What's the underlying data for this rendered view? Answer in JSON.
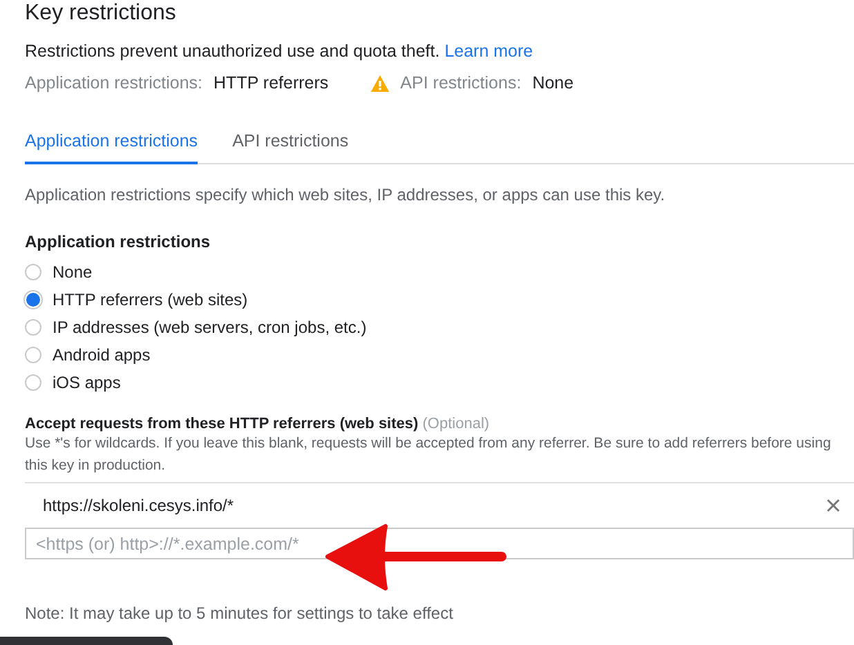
{
  "title": "Key restrictions",
  "description": {
    "text": "Restrictions prevent unauthorized use and quota theft.",
    "link": "Learn more"
  },
  "summary": [
    {
      "label": "Application restrictions:",
      "value": "HTTP referrers",
      "warning": false
    },
    {
      "label": "API restrictions:",
      "value": "None",
      "warning": true
    }
  ],
  "tabs": [
    {
      "label": "Application restrictions",
      "selected": true
    },
    {
      "label": "API restrictions",
      "selected": false
    }
  ],
  "intro": "Application restrictions specify which web sites, IP addresses, or apps can use this key.",
  "radio_group": {
    "heading": "Application restrictions",
    "options": [
      {
        "label": "None",
        "selected": false
      },
      {
        "label": "HTTP referrers (web sites)",
        "selected": true
      },
      {
        "label": "IP addresses (web servers, cron jobs, etc.)",
        "selected": false
      },
      {
        "label": "Android apps",
        "selected": false
      },
      {
        "label": "iOS apps",
        "selected": false
      }
    ]
  },
  "referrers": {
    "label": "Accept requests from these HTTP referrers (web sites)",
    "optional": "(Optional)",
    "help": "Use *'s for wildcards. If you leave this blank, requests will be accepted from any referrer. Be sure to add referrers before using this key in production.",
    "items": [
      "https://skoleni.cesys.info/*"
    ],
    "input": {
      "placeholder": "<https (or) http>://*.example.com/*"
    }
  },
  "note": "Note: It may take up to 5 minutes for settings to take effect"
}
